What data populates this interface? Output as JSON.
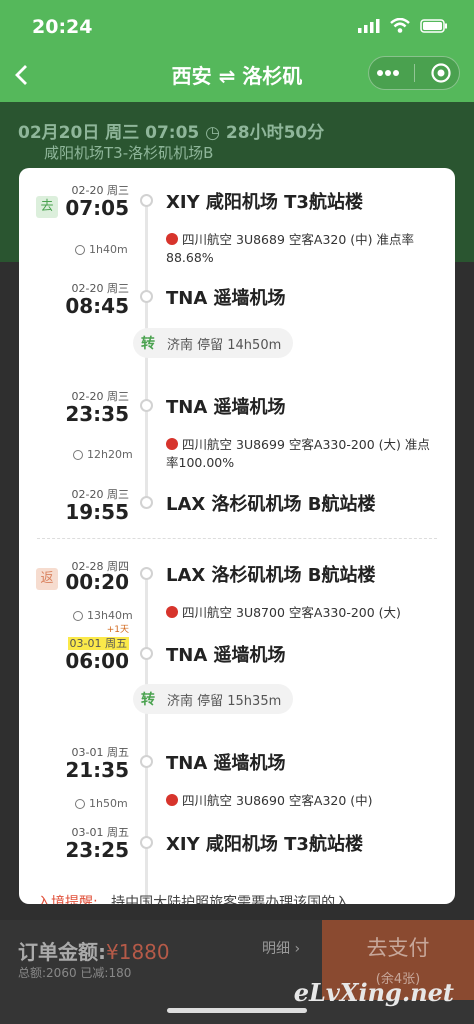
{
  "status_bar": {
    "time": "20:24"
  },
  "nav": {
    "title": "西安 ⇌ 洛杉矶"
  },
  "summary": {
    "line1": "02月20日  周三  07:05  ◷ 28小时50分",
    "line2": "咸阳机场T3-洛杉矶机场B"
  },
  "modal": {
    "outbound_badge": "去",
    "return_badge": "返",
    "outbound": [
      {
        "date": "02-20 周三",
        "time": "07:05",
        "airport": "XIY 咸阳机场 T3航站楼"
      },
      {
        "duration": "1h40m",
        "airline": "四川航空",
        "flight": "3U8689",
        "plane": "空客A320 (中)",
        "ontime_label": "准点率",
        "ontime": "88.68%"
      },
      {
        "date": "02-20 周三",
        "time": "08:45",
        "airport": "TNA 遥墙机场"
      },
      {
        "stop_icon": "转",
        "stop": "济南 停留 14h50m"
      },
      {
        "date": "02-20 周三",
        "time": "23:35",
        "airport": "TNA 遥墙机场"
      },
      {
        "duration": "12h20m",
        "airline": "四川航空",
        "flight": "3U8699",
        "plane": "空客A330-200 (大)",
        "ontime_label": "准点率",
        "ontime": "100.00%"
      },
      {
        "date": "02-20 周三",
        "time": "19:55",
        "airport": "LAX 洛杉矶机场 B航站楼"
      }
    ],
    "return": [
      {
        "date": "02-28 周四",
        "time": "00:20",
        "airport": "LAX 洛杉矶机场 B航站楼"
      },
      {
        "duration": "13h40m",
        "airline": "四川航空",
        "flight": "3U8700",
        "plane": "空客A330-200 (大)"
      },
      {
        "plus_day": "+1天",
        "date": "03-01 周五",
        "time": "06:00",
        "airport": "TNA 遥墙机场"
      },
      {
        "stop_icon": "转",
        "stop": "济南 停留 15h35m"
      },
      {
        "date": "03-01 周五",
        "time": "21:35",
        "airport": "TNA 遥墙机场"
      },
      {
        "duration": "1h50m",
        "airline": "四川航空",
        "flight": "3U8690",
        "plane": "空客A320 (中)"
      },
      {
        "date": "03-01 周五",
        "time": "23:25",
        "airport": "XIY 咸阳机场 T3航站楼"
      }
    ],
    "tip_label": "入境提醒:",
    "tip_text": "持中国大陆护照旅客需要办理该国的入"
  },
  "footer": {
    "amount_label": "订单金额:",
    "amount": "¥1880",
    "sub": "总额:2060 已减:180",
    "detail": "明细 ›",
    "pay": "去支付",
    "pay_sub": "(余4张)"
  },
  "watermark": "eLvXing.net"
}
